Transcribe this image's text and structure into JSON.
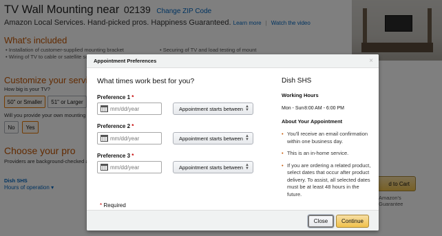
{
  "background": {
    "title": "TV Wall Mounting",
    "title_near": "near",
    "zip": "02139",
    "change_zip": "Change ZIP Code",
    "subtitle": "Amazon Local Services. Hand-picked pros. Happiness Guaranteed.",
    "learn_more": "Learn more",
    "divider": "|",
    "watch_video": "Watch the video",
    "whats_included": "What's included",
    "included_items": [
      "Installation of customer-supplied mounting bracket",
      "Wiring of TV to cable or satellite so",
      "Securing of TV and load testing of mount"
    ],
    "customize": "Customize your service",
    "how_big": "How big is your TV?",
    "size_options": [
      "50\" or Smaller",
      "51\" or Larger"
    ],
    "own_mounting": "Will you provide your own mounting b",
    "yes_no": [
      "No",
      "Yes"
    ],
    "choose_pro": "Choose your pro",
    "background_checked": "Providers are background-checked a",
    "pro_name": "Dish SHS",
    "hours_link": "Hours of operation",
    "hours_caret": "▾",
    "add_to_cart": "d to Cart",
    "guarantee_line1": "Amazon's",
    "guarantee_line2": "Guarantee"
  },
  "modal": {
    "title": "Appointment Preferences",
    "close_glyph": "×",
    "question": "What times work best for you?",
    "required_mark": "*",
    "preferences": [
      {
        "label": "Preference 1",
        "placeholder": "mm/dd/year",
        "select": "Appointment starts between"
      },
      {
        "label": "Preference 2",
        "placeholder": "mm/dd/year",
        "select": "Appointment starts between"
      },
      {
        "label": "Preference 3",
        "placeholder": "mm/dd/year",
        "select": "Appointment starts between"
      }
    ],
    "required_note": "Required",
    "pro_name": "Dish SHS",
    "working_hours_heading": "Working Hours",
    "working_days": "Mon - Sun",
    "working_times": "8:00 AM - 6:00 PM",
    "about_heading": "About Your Appointment",
    "about_items": [
      "You'll receive an email confirmation within one business day.",
      "This is an in-home service.",
      "If you are ordering a related product, select dates that occur after product delivery. To assist, all selected dates must be at least 48 hours in the future."
    ],
    "close_button": "Close",
    "continue_button": "Continue"
  },
  "colors": {
    "accent_orange": "#c45500",
    "link_blue": "#0066c0",
    "button_gold": "#f0c14b",
    "required_red": "#c40000"
  }
}
